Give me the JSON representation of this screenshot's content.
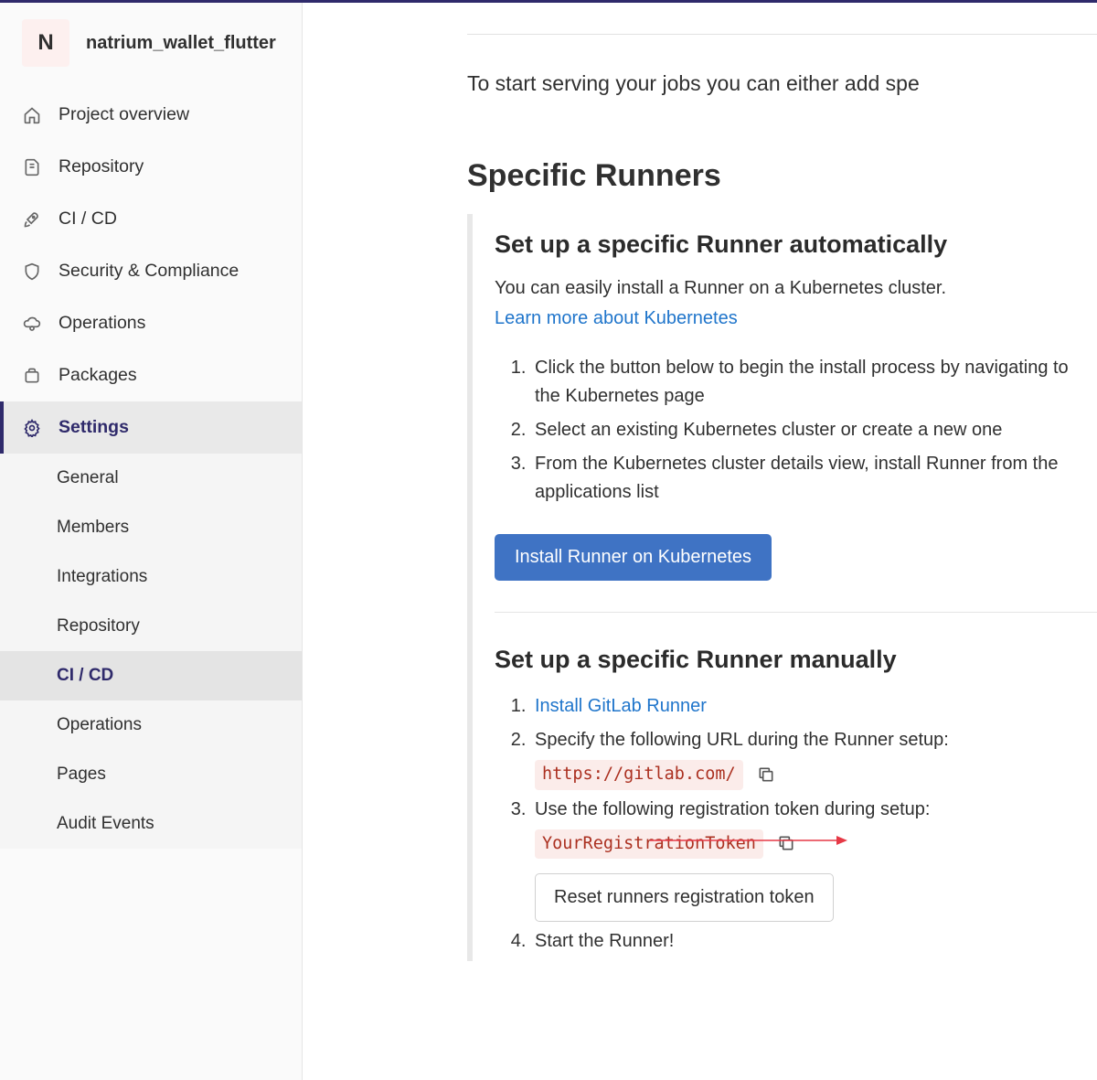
{
  "project": {
    "avatar_letter": "N",
    "name": "natrium_wallet_flutter"
  },
  "sidebar": {
    "items": [
      {
        "label": "Project overview"
      },
      {
        "label": "Repository"
      },
      {
        "label": "CI / CD"
      },
      {
        "label": "Security & Compliance"
      },
      {
        "label": "Operations"
      },
      {
        "label": "Packages"
      },
      {
        "label": "Settings"
      }
    ],
    "subitems": [
      {
        "label": "General"
      },
      {
        "label": "Members"
      },
      {
        "label": "Integrations"
      },
      {
        "label": "Repository"
      },
      {
        "label": "CI / CD"
      },
      {
        "label": "Operations"
      },
      {
        "label": "Pages"
      },
      {
        "label": "Audit Events"
      }
    ]
  },
  "main": {
    "intro": "To start serving your jobs you can either add spe",
    "section_title": "Specific Runners",
    "auto": {
      "title": "Set up a specific Runner automatically",
      "desc": "You can easily install a Runner on a Kubernetes cluster.",
      "learn_more": "Learn more about Kubernetes",
      "steps": [
        "Click the button below to begin the install process by navigating to the Kubernetes page",
        "Select an existing Kubernetes cluster or create a new one",
        "From the Kubernetes cluster details view, install Runner from the applications list"
      ],
      "button": "Install Runner on Kubernetes"
    },
    "manual": {
      "title": "Set up a specific Runner manually",
      "step1_link": "Install GitLab Runner",
      "step2_text": "Specify the following URL during the Runner setup:",
      "url_code": "https://gitlab.com/",
      "step3_text": "Use the following registration token during setup:",
      "token_code": "YourRegistrationToken",
      "reset_button": "Reset runners registration token",
      "step4_text": "Start the Runner!"
    }
  }
}
